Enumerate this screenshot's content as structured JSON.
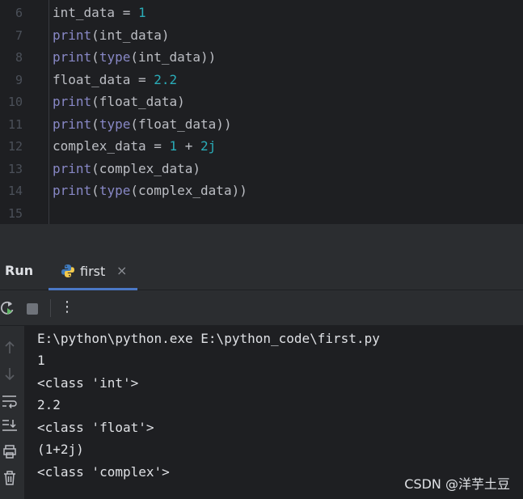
{
  "editor": {
    "lines": [
      {
        "num": "6",
        "tokens": [
          {
            "t": "int_data = ",
            "c": "plain"
          },
          {
            "t": "1",
            "c": "num"
          }
        ]
      },
      {
        "num": "7",
        "tokens": [
          {
            "t": "print",
            "c": "kw"
          },
          {
            "t": "(int_data)",
            "c": "plain"
          }
        ]
      },
      {
        "num": "8",
        "tokens": [
          {
            "t": "print",
            "c": "kw"
          },
          {
            "t": "(",
            "c": "plain"
          },
          {
            "t": "type",
            "c": "kw"
          },
          {
            "t": "(int_data))",
            "c": "plain"
          }
        ]
      },
      {
        "num": "9",
        "tokens": [
          {
            "t": "float_data = ",
            "c": "plain"
          },
          {
            "t": "2.2",
            "c": "num"
          }
        ]
      },
      {
        "num": "10",
        "tokens": [
          {
            "t": "print",
            "c": "kw"
          },
          {
            "t": "(float_data)",
            "c": "plain"
          }
        ]
      },
      {
        "num": "11",
        "tokens": [
          {
            "t": "print",
            "c": "kw"
          },
          {
            "t": "(",
            "c": "plain"
          },
          {
            "t": "type",
            "c": "kw"
          },
          {
            "t": "(float_data))",
            "c": "plain"
          }
        ]
      },
      {
        "num": "12",
        "tokens": [
          {
            "t": "complex_data = ",
            "c": "plain"
          },
          {
            "t": "1",
            "c": "num"
          },
          {
            "t": " + ",
            "c": "plain"
          },
          {
            "t": "2j",
            "c": "num"
          }
        ]
      },
      {
        "num": "13",
        "tokens": [
          {
            "t": "print",
            "c": "kw"
          },
          {
            "t": "(complex_data)",
            "c": "plain"
          }
        ]
      },
      {
        "num": "14",
        "tokens": [
          {
            "t": "print",
            "c": "kw"
          },
          {
            "t": "(",
            "c": "plain"
          },
          {
            "t": "type",
            "c": "kw"
          },
          {
            "t": "(complex_data))",
            "c": "plain"
          }
        ]
      },
      {
        "num": "15",
        "tokens": []
      }
    ]
  },
  "run_panel": {
    "title": "Run",
    "tab": {
      "label": "first",
      "icon": "python-icon",
      "close": "×"
    },
    "toolbar": {
      "rerun_icon": "rerun-icon",
      "stop_icon": "stop-icon",
      "more": "⋮"
    }
  },
  "console": {
    "lines": [
      "E:\\python\\python.exe E:\\python_code\\first.py",
      "1",
      "<class 'int'>",
      "2.2",
      "<class 'float'>",
      "(1+2j)",
      "<class 'complex'>"
    ],
    "side_icons": [
      "up-arrow-icon",
      "down-arrow-icon",
      "soft-wrap-icon",
      "scroll-to-end-icon",
      "print-icon",
      "trash-icon"
    ]
  },
  "watermark": "CSDN @洋芋土豆",
  "colors": {
    "keyword": "#8888c6",
    "number": "#2aacb8",
    "text": "#bcbec4",
    "accent": "#4b78c6"
  }
}
